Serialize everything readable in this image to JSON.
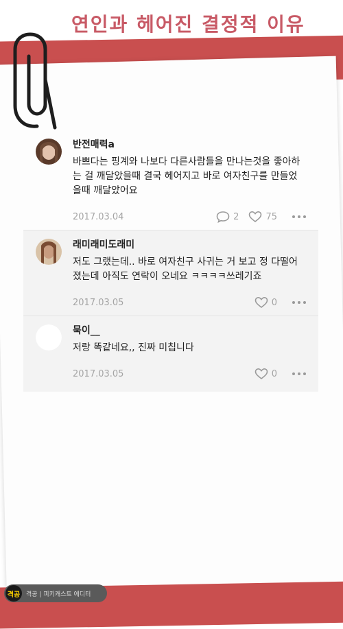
{
  "title": "연인과 헤어진 결정적 이유",
  "comments": [
    {
      "author": "반전매력a",
      "text": "바쁘다는 핑계와 나보다 다른사람들을 만나는것을 좋아하는 걸 깨달았을때 결국 헤어지고 바로 여자친구를 만들었을때 깨달았어요",
      "date": "2017.03.04",
      "reply_count": "2",
      "like_count": "75",
      "avatar_color": "#6b4a3a"
    },
    {
      "author": "래미래미도래미",
      "text": "저도 그랬는데.. 바로 여자친구 사귀는 거 보고 정 다떨어졌는데 아직도 연락이 오네요 ㅋㅋㅋㅋ쓰레기죠",
      "date": "2017.03.05",
      "like_count": "0",
      "avatar_color": "#8a5a44"
    },
    {
      "author": "묵이__",
      "text": "저랑 똑같네요,, 진짜 미칩니다",
      "date": "2017.03.05",
      "like_count": "0",
      "avatar_color": "#ffffff"
    }
  ],
  "watermark": {
    "logo": "격공",
    "text": "격공 | 피키캐스트 에디터"
  },
  "colors": {
    "accent_red": "#c94f4f",
    "title_pink": "#c85a66"
  }
}
